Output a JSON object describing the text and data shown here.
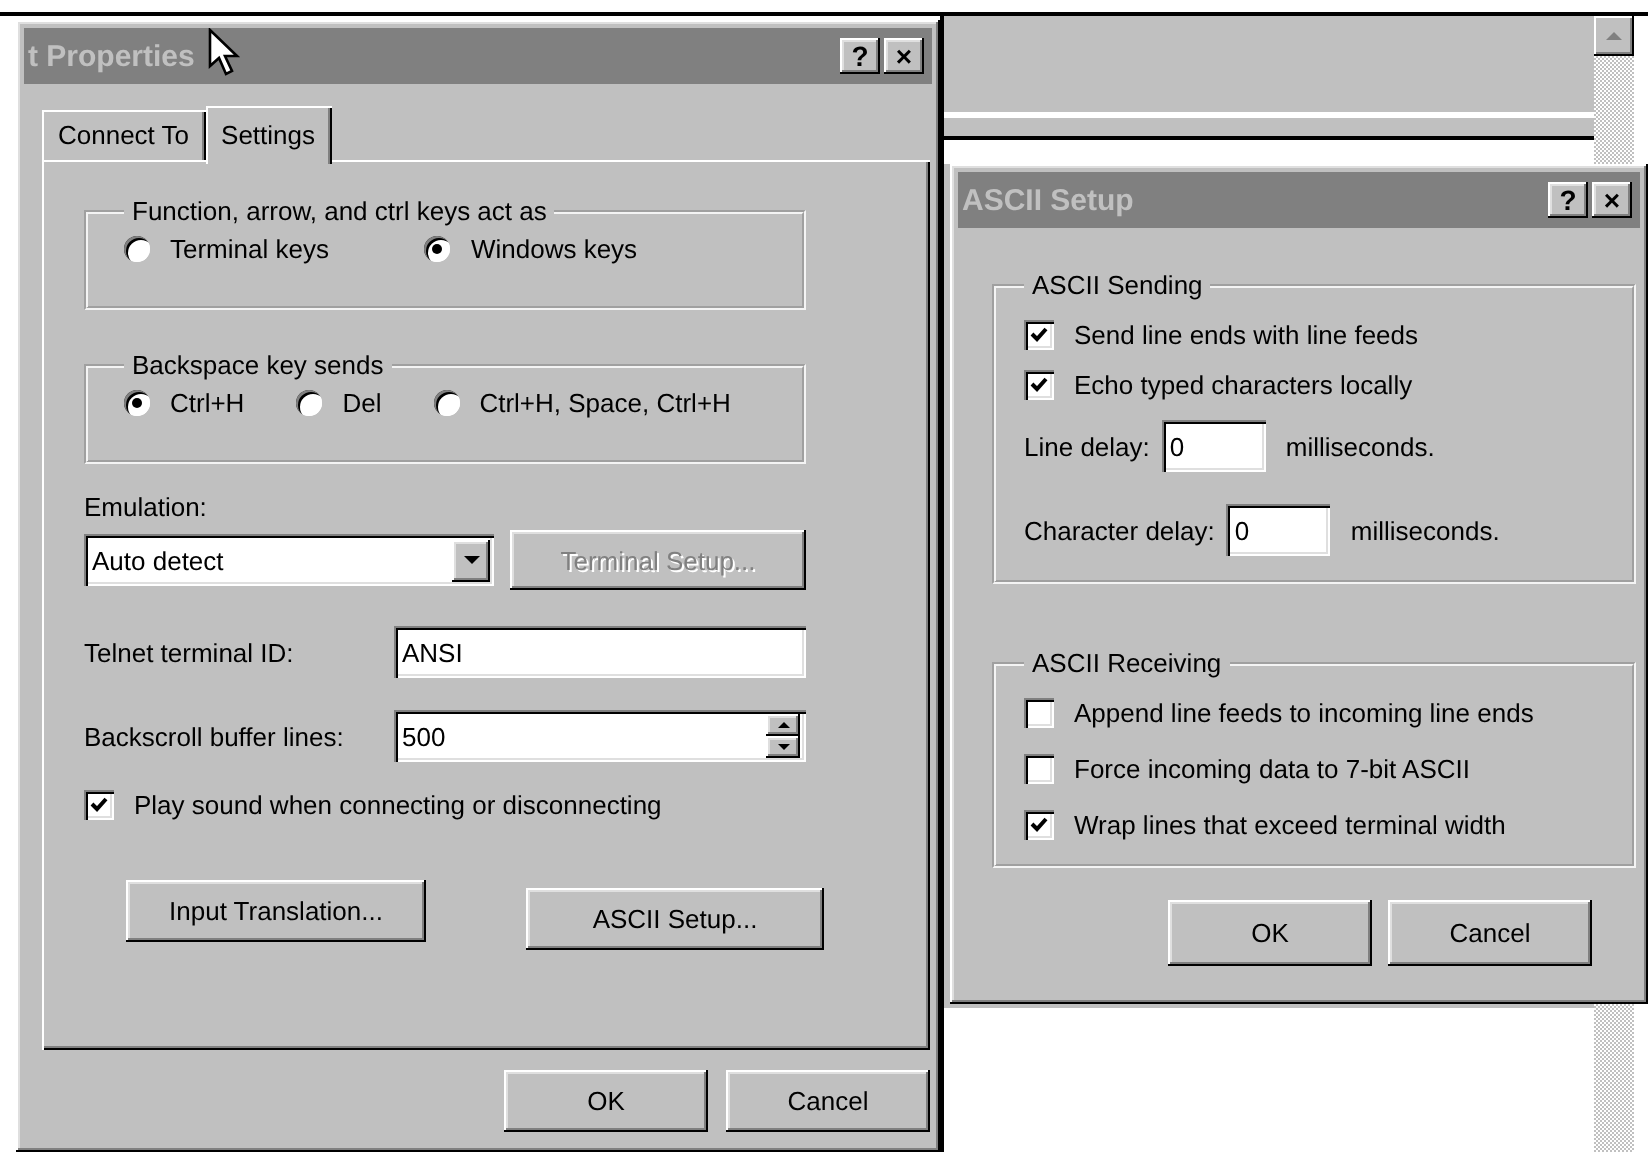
{
  "properties_dialog": {
    "title": "t Properties",
    "title_buttons": [
      "?",
      "×"
    ],
    "tabs": [
      {
        "label": "Connect To",
        "selected": false
      },
      {
        "label": "Settings",
        "selected": true
      }
    ],
    "keys_group": {
      "title": "Function, arrow, and ctrl keys act as",
      "options": [
        {
          "label": "Terminal keys",
          "selected": false
        },
        {
          "label": "Windows keys",
          "selected": true
        }
      ]
    },
    "backspace_group": {
      "title": "Backspace key sends",
      "options": [
        {
          "label": "Ctrl+H",
          "selected": true
        },
        {
          "label": "Del",
          "selected": false
        },
        {
          "label": "Ctrl+H, Space, Ctrl+H",
          "selected": false
        }
      ]
    },
    "emulation": {
      "label": "Emulation:",
      "value": "Auto detect"
    },
    "terminal_setup_button": {
      "label": "Terminal Setup...",
      "disabled": true
    },
    "telnet_id": {
      "label": "Telnet terminal ID:",
      "value": "ANSI"
    },
    "backscroll": {
      "label": "Backscroll buffer lines:",
      "value": "500"
    },
    "play_sound": {
      "label": "Play sound when connecting or disconnecting",
      "checked": true
    },
    "buttons": [
      "Input Translation...",
      "ASCII Setup..."
    ],
    "footer_buttons": [
      "OK",
      "Cancel"
    ]
  },
  "ascii_dialog": {
    "title": "ASCII Setup",
    "title_buttons": [
      "?",
      "×"
    ],
    "sending": {
      "title": "ASCII Sending",
      "checks": [
        {
          "label": "Send line ends with line feeds",
          "checked": true
        },
        {
          "label": "Echo typed characters locally",
          "checked": true
        }
      ],
      "delays": [
        {
          "label": "Line delay:",
          "value": "0",
          "unit": "milliseconds."
        },
        {
          "label": "Character delay:",
          "value": "0",
          "unit": "milliseconds."
        }
      ]
    },
    "receiving": {
      "title": "ASCII Receiving",
      "checks": [
        {
          "label": "Append line feeds to incoming line ends",
          "checked": false
        },
        {
          "label": "Force incoming data to 7-bit ASCII",
          "checked": false
        },
        {
          "label": "Wrap lines that exceed terminal width",
          "checked": true
        }
      ]
    },
    "buttons": [
      "OK",
      "Cancel"
    ]
  }
}
